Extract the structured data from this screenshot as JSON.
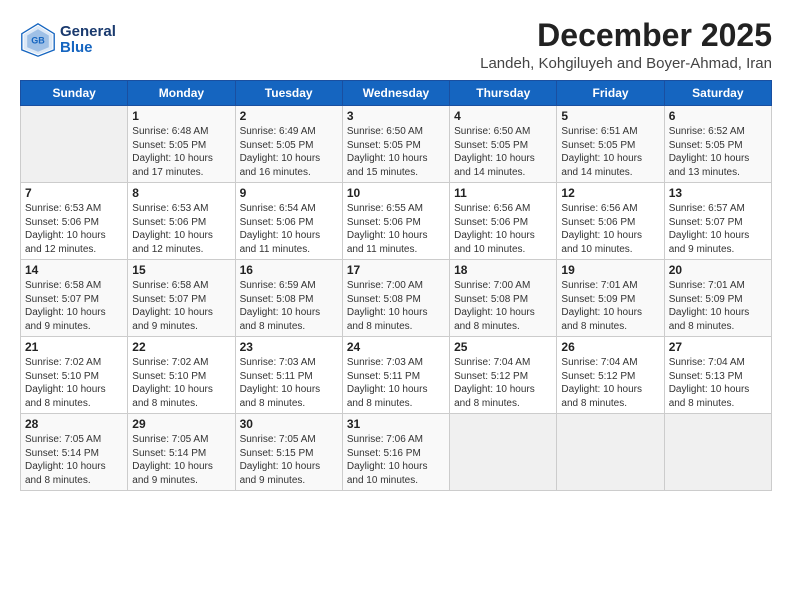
{
  "header": {
    "logo_line1": "General",
    "logo_line2": "Blue",
    "title": "December 2025",
    "subtitle": "Landeh, Kohgiluyeh and Boyer-Ahmad, Iran"
  },
  "calendar": {
    "days_of_week": [
      "Sunday",
      "Monday",
      "Tuesday",
      "Wednesday",
      "Thursday",
      "Friday",
      "Saturday"
    ],
    "weeks": [
      [
        {
          "day": "",
          "info": ""
        },
        {
          "day": "1",
          "info": "Sunrise: 6:48 AM\nSunset: 5:05 PM\nDaylight: 10 hours\nand 17 minutes."
        },
        {
          "day": "2",
          "info": "Sunrise: 6:49 AM\nSunset: 5:05 PM\nDaylight: 10 hours\nand 16 minutes."
        },
        {
          "day": "3",
          "info": "Sunrise: 6:50 AM\nSunset: 5:05 PM\nDaylight: 10 hours\nand 15 minutes."
        },
        {
          "day": "4",
          "info": "Sunrise: 6:50 AM\nSunset: 5:05 PM\nDaylight: 10 hours\nand 14 minutes."
        },
        {
          "day": "5",
          "info": "Sunrise: 6:51 AM\nSunset: 5:05 PM\nDaylight: 10 hours\nand 14 minutes."
        },
        {
          "day": "6",
          "info": "Sunrise: 6:52 AM\nSunset: 5:05 PM\nDaylight: 10 hours\nand 13 minutes."
        }
      ],
      [
        {
          "day": "7",
          "info": "Sunrise: 6:53 AM\nSunset: 5:06 PM\nDaylight: 10 hours\nand 12 minutes."
        },
        {
          "day": "8",
          "info": "Sunrise: 6:53 AM\nSunset: 5:06 PM\nDaylight: 10 hours\nand 12 minutes."
        },
        {
          "day": "9",
          "info": "Sunrise: 6:54 AM\nSunset: 5:06 PM\nDaylight: 10 hours\nand 11 minutes."
        },
        {
          "day": "10",
          "info": "Sunrise: 6:55 AM\nSunset: 5:06 PM\nDaylight: 10 hours\nand 11 minutes."
        },
        {
          "day": "11",
          "info": "Sunrise: 6:56 AM\nSunset: 5:06 PM\nDaylight: 10 hours\nand 10 minutes."
        },
        {
          "day": "12",
          "info": "Sunrise: 6:56 AM\nSunset: 5:06 PM\nDaylight: 10 hours\nand 10 minutes."
        },
        {
          "day": "13",
          "info": "Sunrise: 6:57 AM\nSunset: 5:07 PM\nDaylight: 10 hours\nand 9 minutes."
        }
      ],
      [
        {
          "day": "14",
          "info": "Sunrise: 6:58 AM\nSunset: 5:07 PM\nDaylight: 10 hours\nand 9 minutes."
        },
        {
          "day": "15",
          "info": "Sunrise: 6:58 AM\nSunset: 5:07 PM\nDaylight: 10 hours\nand 9 minutes."
        },
        {
          "day": "16",
          "info": "Sunrise: 6:59 AM\nSunset: 5:08 PM\nDaylight: 10 hours\nand 8 minutes."
        },
        {
          "day": "17",
          "info": "Sunrise: 7:00 AM\nSunset: 5:08 PM\nDaylight: 10 hours\nand 8 minutes."
        },
        {
          "day": "18",
          "info": "Sunrise: 7:00 AM\nSunset: 5:08 PM\nDaylight: 10 hours\nand 8 minutes."
        },
        {
          "day": "19",
          "info": "Sunrise: 7:01 AM\nSunset: 5:09 PM\nDaylight: 10 hours\nand 8 minutes."
        },
        {
          "day": "20",
          "info": "Sunrise: 7:01 AM\nSunset: 5:09 PM\nDaylight: 10 hours\nand 8 minutes."
        }
      ],
      [
        {
          "day": "21",
          "info": "Sunrise: 7:02 AM\nSunset: 5:10 PM\nDaylight: 10 hours\nand 8 minutes."
        },
        {
          "day": "22",
          "info": "Sunrise: 7:02 AM\nSunset: 5:10 PM\nDaylight: 10 hours\nand 8 minutes."
        },
        {
          "day": "23",
          "info": "Sunrise: 7:03 AM\nSunset: 5:11 PM\nDaylight: 10 hours\nand 8 minutes."
        },
        {
          "day": "24",
          "info": "Sunrise: 7:03 AM\nSunset: 5:11 PM\nDaylight: 10 hours\nand 8 minutes."
        },
        {
          "day": "25",
          "info": "Sunrise: 7:04 AM\nSunset: 5:12 PM\nDaylight: 10 hours\nand 8 minutes."
        },
        {
          "day": "26",
          "info": "Sunrise: 7:04 AM\nSunset: 5:12 PM\nDaylight: 10 hours\nand 8 minutes."
        },
        {
          "day": "27",
          "info": "Sunrise: 7:04 AM\nSunset: 5:13 PM\nDaylight: 10 hours\nand 8 minutes."
        }
      ],
      [
        {
          "day": "28",
          "info": "Sunrise: 7:05 AM\nSunset: 5:14 PM\nDaylight: 10 hours\nand 8 minutes."
        },
        {
          "day": "29",
          "info": "Sunrise: 7:05 AM\nSunset: 5:14 PM\nDaylight: 10 hours\nand 9 minutes."
        },
        {
          "day": "30",
          "info": "Sunrise: 7:05 AM\nSunset: 5:15 PM\nDaylight: 10 hours\nand 9 minutes."
        },
        {
          "day": "31",
          "info": "Sunrise: 7:06 AM\nSunset: 5:16 PM\nDaylight: 10 hours\nand 10 minutes."
        },
        {
          "day": "",
          "info": ""
        },
        {
          "day": "",
          "info": ""
        },
        {
          "day": "",
          "info": ""
        }
      ]
    ]
  }
}
